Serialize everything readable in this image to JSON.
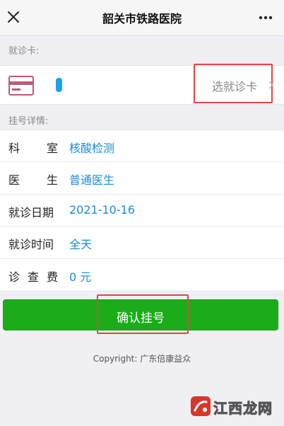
{
  "header": {
    "title": "韶关市铁路医院",
    "close_icon": "close-icon",
    "more_icon": "more-icon"
  },
  "card_section": {
    "label": "就诊卡:",
    "select_card_label": "选就诊卡",
    "icon": "credit-card-icon"
  },
  "detail_section": {
    "label": "挂号详情:",
    "rows": [
      {
        "label_chars": [
          "科",
          "室"
        ],
        "value": "核酸检测"
      },
      {
        "label_chars": [
          "医",
          "生"
        ],
        "value": "普通医生"
      },
      {
        "label_chars": [
          "就诊日期"
        ],
        "value": "2021-10-16"
      },
      {
        "label_chars": [
          "就诊时间"
        ],
        "value": "全天"
      },
      {
        "label_chars": [
          "诊",
          "查",
          "费"
        ],
        "value": "0 元"
      }
    ]
  },
  "confirm_button": {
    "label": "确认挂号"
  },
  "footer": {
    "copyright": "Copyright: 广东倍康益众"
  },
  "watermark": {
    "text": "江西龙网",
    "icon": "watermark-logo-icon"
  },
  "colors": {
    "accent_blue": "#1a8cd8",
    "button_green": "#1aad19",
    "highlight_red": "#e64343",
    "card_icon": "#c0577d"
  }
}
